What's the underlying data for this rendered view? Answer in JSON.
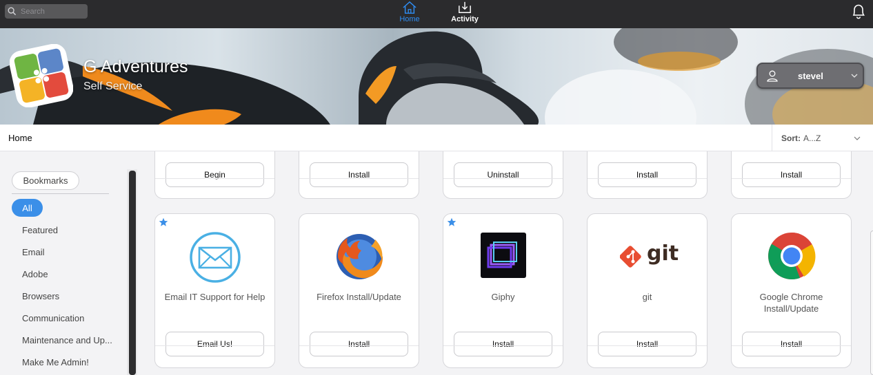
{
  "search": {
    "placeholder": "Search"
  },
  "nav": {
    "home_label": "Home",
    "activity_label": "Activity"
  },
  "brand": {
    "title": "G Adventures",
    "subtitle": "Self Service"
  },
  "user": {
    "name": "stevel"
  },
  "breadcrumb": {
    "current": "Home"
  },
  "sort": {
    "label": "Sort:",
    "value": "A...Z"
  },
  "sidebar": {
    "bookmarks_label": "Bookmarks",
    "active_category": "All",
    "categories": [
      "Featured",
      "Email",
      "Adobe",
      "Browsers",
      "Communication",
      "Maintenance and Up...",
      "Make Me Admin!"
    ]
  },
  "top_row_buttons": [
    "Begin",
    "Install",
    "Uninstall",
    "Install",
    "Install"
  ],
  "apps": [
    {
      "name": "Email IT Support for Help",
      "button": "Email Us!",
      "icon": "envelope-icon",
      "featured": true
    },
    {
      "name": "Firefox Install/Update",
      "button": "Install",
      "icon": "firefox-icon",
      "featured": false
    },
    {
      "name": "Giphy",
      "button": "Install",
      "icon": "giphy-icon",
      "featured": true
    },
    {
      "name": "git",
      "button": "Install",
      "icon": "git-icon",
      "featured": false,
      "logo_text": "git"
    },
    {
      "name": "Google Chrome Install/Update",
      "button": "Install",
      "icon": "chrome-icon",
      "featured": false
    }
  ],
  "colors": {
    "accent": "#3b8fe8",
    "topbar": "#2b2b2d",
    "home_active": "#2e8ef5"
  }
}
